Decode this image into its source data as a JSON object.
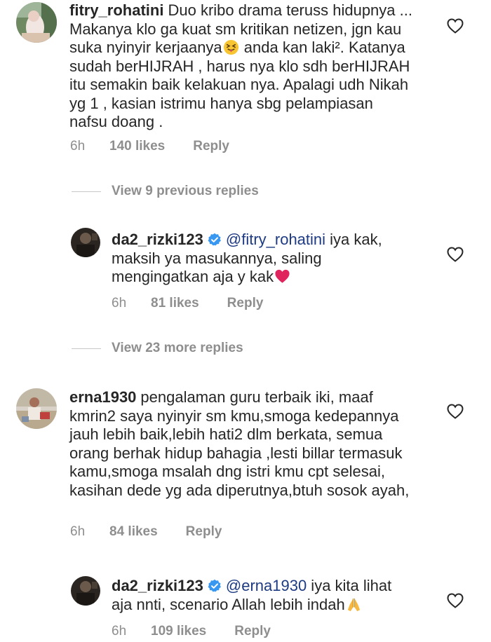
{
  "comments": [
    {
      "username": "fitry_rohatini",
      "text_before_emoji": "Duo kribo drama teruss hidupnya ... Makanya klo ga kuat sm kritikan netizen, jgn kau  suka nyinyir kerjaanya",
      "emoji": "squinting-tongue-face",
      "text_after_emoji": " anda kan laki². Katanya sudah berHIJRAH , harus nya klo sdh berHIJRAH itu semakin baik kelakuan nya. Apalagi udh Nikah yg 1 , kasian istrimu hanya sbg pelampiasan nafsu doang .",
      "time": "6h",
      "likes": "140 likes",
      "reply": "Reply"
    },
    {
      "username": "da2_rizki123",
      "mention": "@fitry_rohatini",
      "text": " iya kak, maksih ya masukannya, saling mengingatkan aja y kak",
      "emoji": "red-heart",
      "time": "6h",
      "likes": "81 likes",
      "reply": "Reply"
    },
    {
      "username": "erna1930",
      "text": "pengalaman guru terbaik iki, maaf kmrin2 saya nyinyir sm kmu,smoga kedepannya jauh lebih baik,lebih hati2 dlm berkata, semua orang berhak hidup bahagia ,lesti billar termasuk kamu,smoga msalah dng istri kmu cpt selesai, kasihan dede yg ada diperutnya,btuh sosok ayah,",
      "time": "6h",
      "likes": "84 likes",
      "reply": "Reply"
    },
    {
      "username": "da2_rizki123",
      "mention": "@erna1930",
      "text": " iya kita lihat aja nnti, scenario Allah lebih indah",
      "emoji": "folded-hands",
      "time": "6h",
      "likes": "109 likes",
      "reply": "Reply"
    }
  ],
  "view_replies": {
    "previous": "View 9 previous replies",
    "more": "View 23 more replies"
  },
  "colors": {
    "text": "#262626",
    "secondary": "#8e8e8e",
    "mention": "#1d3a82",
    "verified": "#3897f0",
    "heart_emoji": "#e0245e"
  }
}
